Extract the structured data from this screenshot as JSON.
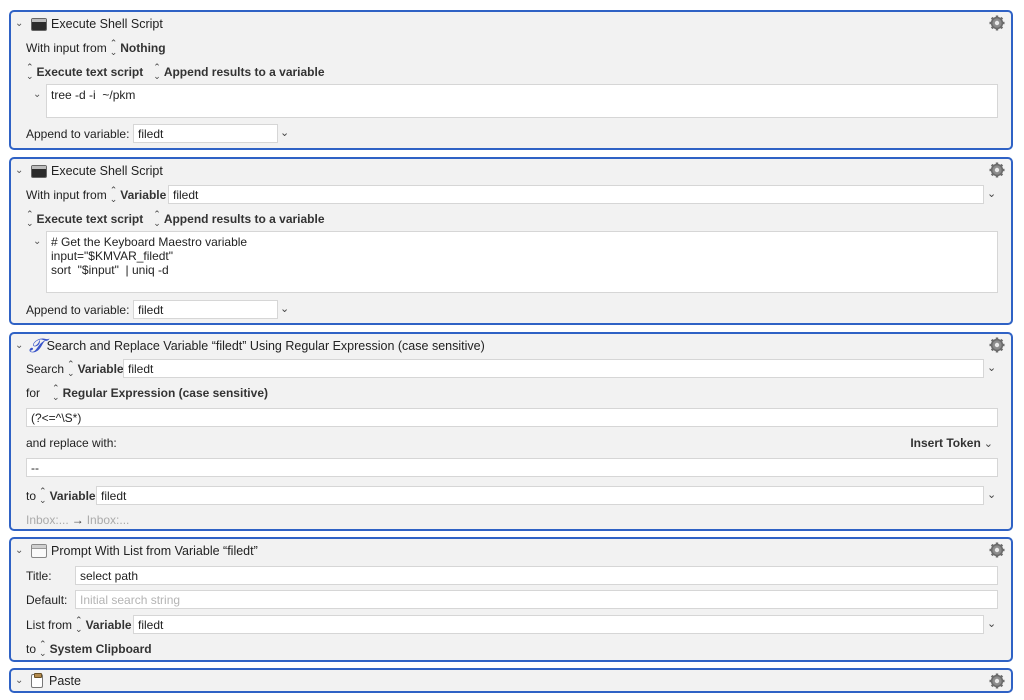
{
  "actions": [
    {
      "title": "Execute Shell Script",
      "input_label": "With input from",
      "input_source": "Nothing",
      "mode": "Execute text script",
      "output": "Append results to a variable",
      "script": "tree -d -i  ~/pkm",
      "append_label": "Append to variable:",
      "append_var": "filedt"
    },
    {
      "title": "Execute Shell Script",
      "input_label": "With input from",
      "input_source": "Variable",
      "input_var": "filedt",
      "mode": "Execute text script",
      "output": "Append results to a variable",
      "script": "# Get the Keyboard Maestro variable\ninput=\"$KMVAR_filedt\"\nsort  \"$input\"  | uniq -d",
      "append_label": "Append to variable:",
      "append_var": "filedt"
    },
    {
      "title": "Search and Replace Variable “filedt” Using Regular Expression (case sensitive)",
      "search_label": "Search",
      "search_source": "Variable",
      "search_var": "filedt",
      "for_label": "for",
      "for_mode": "Regular Expression (case sensitive)",
      "pattern": "(?<=^\\S*)",
      "replace_label": "and replace with:",
      "insert_token": "Insert Token",
      "replacement": "--",
      "to_label": "to",
      "to_source": "Variable",
      "to_var": "filedt",
      "inbox_from": "Inbox:...",
      "arrow": "→",
      "inbox_to": "Inbox:..."
    },
    {
      "title": "Prompt With List from Variable “filedt”",
      "title_label": "Title:",
      "title_value": "select path",
      "default_label": "Default:",
      "default_placeholder": "Initial search string",
      "list_label": "List from",
      "list_source": "Variable",
      "list_var": "filedt",
      "to_label": "to",
      "to_dest": "System Clipboard"
    },
    {
      "title": "Paste"
    }
  ],
  "colors": {
    "border": "#2f62c5",
    "panel": "#f2f2f2"
  },
  "icons": {
    "collapse": "chevron-down-icon",
    "terminal": "terminal-icon",
    "regex": "variable-x-icon",
    "window": "window-icon",
    "clipboard": "clipboard-icon",
    "gear": "gear-icon"
  }
}
